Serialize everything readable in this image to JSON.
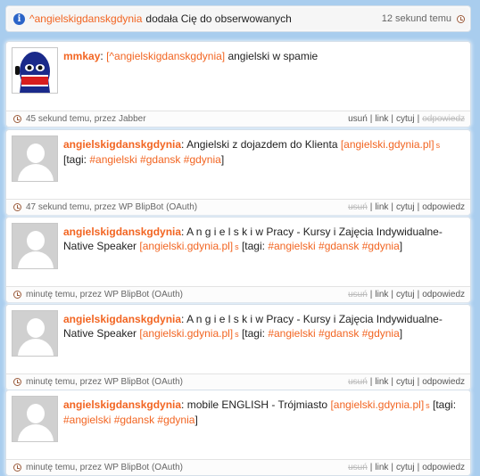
{
  "notice": {
    "user": "^angielskigdanskgdynia",
    "text": "dodała Cię do obserwowanych",
    "time": "12 sekund temu"
  },
  "posts": [
    {
      "author": "mmkay",
      "sep": ":",
      "link": "[^angielskigdanskgdynia]",
      "text": " angielski w spamie",
      "meta": "45 sekund temu, przez Jabber",
      "actions": {
        "delete": "usuń",
        "link": "link",
        "quote": "cytuj",
        "reply": "odpowiedz"
      }
    },
    {
      "author": "angielskigdanskgdynia",
      "sep": ":",
      "text1": " Angielski z dojazdem do Klienta ",
      "link": "[angielski.gdynia.pl]",
      "s": "s",
      "text2": " [tagi: ",
      "tags": "#angielski #gdansk #gdynia",
      "text3": "]",
      "meta": "47 sekund temu, przez WP BlipBot (OAuth)",
      "actions": {
        "delete": "usuń",
        "link": "link",
        "quote": "cytuj",
        "reply": "odpowiedz"
      }
    },
    {
      "author": "angielskigdanskgdynia",
      "sep": ":",
      "text1": " A n g i e l s k i w Pracy - Kursy i Zajęcia Indywidualne-Native Speaker ",
      "link": "[angielski.gdynia.pl]",
      "s": "s",
      "text2": " [tagi: ",
      "tags": "#angielski #gdansk #gdynia",
      "text3": "]",
      "meta": "minutę temu, przez WP BlipBot (OAuth)",
      "actions": {
        "delete": "usuń",
        "link": "link",
        "quote": "cytuj",
        "reply": "odpowiedz"
      }
    },
    {
      "author": "angielskigdanskgdynia",
      "sep": ":",
      "text1": " A n g i e l s k i w Pracy - Kursy i Zajęcia Indywidualne-Native Speaker ",
      "link": "[angielski.gdynia.pl]",
      "s": "s",
      "text2": " [tagi: ",
      "tags": "#angielski #gdansk #gdynia",
      "text3": "]",
      "meta": "minutę temu, przez WP BlipBot (OAuth)",
      "actions": {
        "delete": "usuń",
        "link": "link",
        "quote": "cytuj",
        "reply": "odpowiedz"
      }
    },
    {
      "author": "angielskigdanskgdynia",
      "sep": ":",
      "text1": " mobile ENGLISH - Trójmiasto ",
      "link": "[angielski.gdynia.pl]",
      "s": "s",
      "text2": " [tagi: ",
      "tags": "#angielski #gdansk #gdynia",
      "text3": "]",
      "meta": "minutę temu, przez WP BlipBot (OAuth)",
      "actions": {
        "delete": "usuń",
        "link": "link",
        "quote": "cytuj",
        "reply": "odpowiedz"
      }
    }
  ]
}
